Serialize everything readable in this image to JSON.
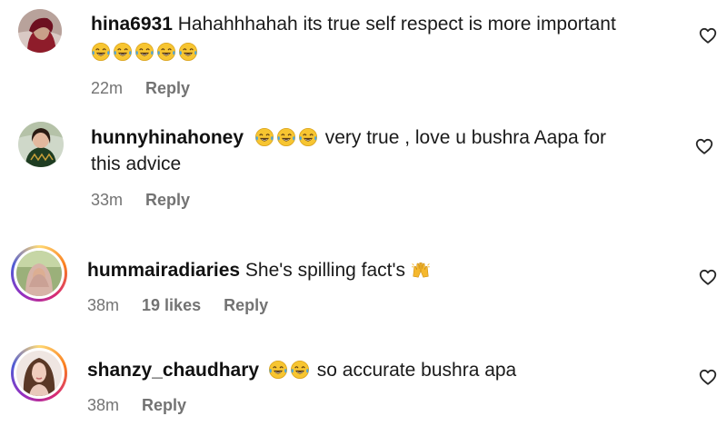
{
  "comments": [
    {
      "username": "hina6931",
      "text": "Hahahhhahah its true self respect is more important",
      "emoji_icon": "face-with-tears-of-joy",
      "emoji_count": 5,
      "time": "22m",
      "likes": "",
      "reply_label": "Reply",
      "like_icon": "heart-outline"
    },
    {
      "username": "hunnyhinahoney",
      "text_line1": "very true , love u bushra Aapa for",
      "text_line2": "this advice",
      "emoji_icon": "face-with-tears-of-joy",
      "emoji_count": 3,
      "time": "33m",
      "likes": "",
      "reply_label": "Reply",
      "like_icon": "heart-outline"
    },
    {
      "username": "hummairadiaries",
      "text": "She's spilling fact's",
      "emoji_icon": "raising-hands",
      "time": "38m",
      "likes": "19 likes",
      "reply_label": "Reply",
      "like_icon": "heart-outline"
    },
    {
      "username": "shanzy_chaudhary",
      "text": "so accurate bushra apa",
      "emoji_icon": "face-with-tears-of-joy",
      "emoji_count": 2,
      "time": "38m",
      "likes": "",
      "reply_label": "Reply",
      "like_icon": "heart-outline"
    }
  ],
  "colors": {
    "meta_gray": "#737373",
    "emoji_yellow": "#f7c531",
    "tear_blue": "#4aa3df",
    "story_ring": "#d62976"
  }
}
